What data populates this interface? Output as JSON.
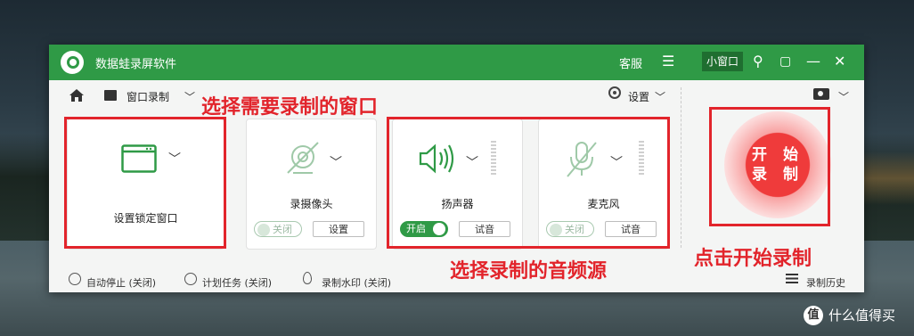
{
  "titlebar": {
    "app_title": "数据蛙录屏软件",
    "support": "客服",
    "menu_icon": "hamburger-icon",
    "small_window": "小窗口",
    "pin_icon": "pin-icon",
    "min_icon": "minimize-icon",
    "restore_icon": "restore-icon",
    "close_icon": "close-icon"
  },
  "toolbar": {
    "home_icon": "home-icon",
    "mode_label": "窗口录制",
    "settings_label": "设置",
    "camera_icon": "camera-icon"
  },
  "cards": {
    "window": {
      "label": "设置锁定窗口"
    },
    "webcam": {
      "label": "录摄像头",
      "toggle": "关闭",
      "button": "设置"
    },
    "speaker": {
      "label": "扬声器",
      "toggle": "开启",
      "button": "试音"
    },
    "mic": {
      "label": "麦克风",
      "toggle": "关闭",
      "button": "试音"
    }
  },
  "start_button": {
    "line1": "开 始",
    "line2": "录 制"
  },
  "statusbar": {
    "auto_stop": "自动停止 (关闭)",
    "scheduled": "计划任务 (关闭)",
    "watermark": "录制水印 (关闭)",
    "history": "录制历史"
  },
  "annotations": {
    "choose_window": "选择需要录制的窗口",
    "choose_audio": "选择录制的音频源",
    "click_start": "点击开始录制"
  },
  "watermark_site": "什么值得买",
  "watermark_logo": "值",
  "colors": {
    "accent_green": "#2f9a46",
    "record_red": "#ef3b3b",
    "annotation_red": "#e2242b"
  }
}
